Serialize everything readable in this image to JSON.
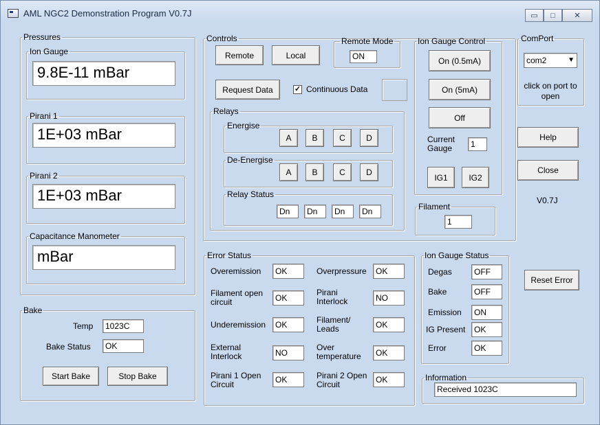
{
  "window": {
    "title": "AML NGC2 Demonstration Program V0.7J",
    "minimize": "▭",
    "maximize": "□",
    "close": "✕"
  },
  "pressures": {
    "legend": "Pressures",
    "ion_gauge": {
      "label": "Ion Gauge",
      "value": "9.8E-11 mBar"
    },
    "pirani1": {
      "label": "Pirani 1",
      "value": "1E+03 mBar"
    },
    "pirani2": {
      "label": "Pirani 2",
      "value": "1E+03 mBar"
    },
    "capacitance": {
      "label": "Capacitance Manometer",
      "value": "mBar"
    }
  },
  "bake": {
    "legend": "Bake",
    "temp_label": "Temp",
    "temp_value": "1023C",
    "status_label": "Bake Status",
    "status_value": "OK",
    "start": "Start Bake",
    "stop": "Stop Bake"
  },
  "controls": {
    "legend": "Controls",
    "remote": "Remote",
    "local": "Local",
    "remote_mode_legend": "Remote Mode",
    "remote_mode_value": "ON",
    "request_data": "Request Data",
    "continuous_label": "Continuous Data",
    "continuous_check": "✓",
    "relays": {
      "legend": "Relays",
      "energise_legend": "Energise",
      "deenergise_legend": "De-Energise",
      "status_legend": "Relay Status",
      "buttons": [
        "A",
        "B",
        "C",
        "D"
      ],
      "status": [
        "Dn",
        "Dn",
        "Dn",
        "Dn"
      ]
    }
  },
  "ion_gauge_control": {
    "legend": "Ion Gauge Control",
    "on_05": "On (0.5mA)",
    "on_5": "On (5mA)",
    "off": "Off",
    "current_gauge_label": "Current Gauge",
    "current_gauge_value": "1",
    "ig1": "IG1",
    "ig2": "IG2"
  },
  "filament": {
    "legend": "Filament",
    "value": "1"
  },
  "comport": {
    "legend": "ComPort",
    "selected": "com2",
    "hint": "click on port to open"
  },
  "side_buttons": {
    "help": "Help",
    "close": "Close",
    "version": "V0.7J",
    "reset_error": "Reset Error"
  },
  "error_status": {
    "legend": "Error Status",
    "items": [
      {
        "label": "Overemission",
        "value": "OK"
      },
      {
        "label": "Overpressure",
        "value": "OK"
      },
      {
        "label": "Filament open circuit",
        "value": "OK"
      },
      {
        "label": "Pirani Interlock",
        "value": "NO"
      },
      {
        "label": "Underemission",
        "value": "OK"
      },
      {
        "label": "Filament/ Leads",
        "value": "OK"
      },
      {
        "label": "External Interlock",
        "value": "NO"
      },
      {
        "label": "Over temperature",
        "value": "OK"
      },
      {
        "label": "Pirani 1 Open Circuit",
        "value": "OK"
      },
      {
        "label": "Pirani 2 Open Circuit",
        "value": "OK"
      }
    ]
  },
  "ion_gauge_status": {
    "legend": "Ion Gauge Status",
    "items": [
      {
        "label": "Degas",
        "value": "OFF"
      },
      {
        "label": "Bake",
        "value": "OFF"
      },
      {
        "label": "Emission",
        "value": "ON"
      },
      {
        "label": "IG Present",
        "value": "OK"
      },
      {
        "label": "Error",
        "value": "OK"
      }
    ]
  },
  "information": {
    "legend": "Information",
    "value": "Received 1023C"
  }
}
